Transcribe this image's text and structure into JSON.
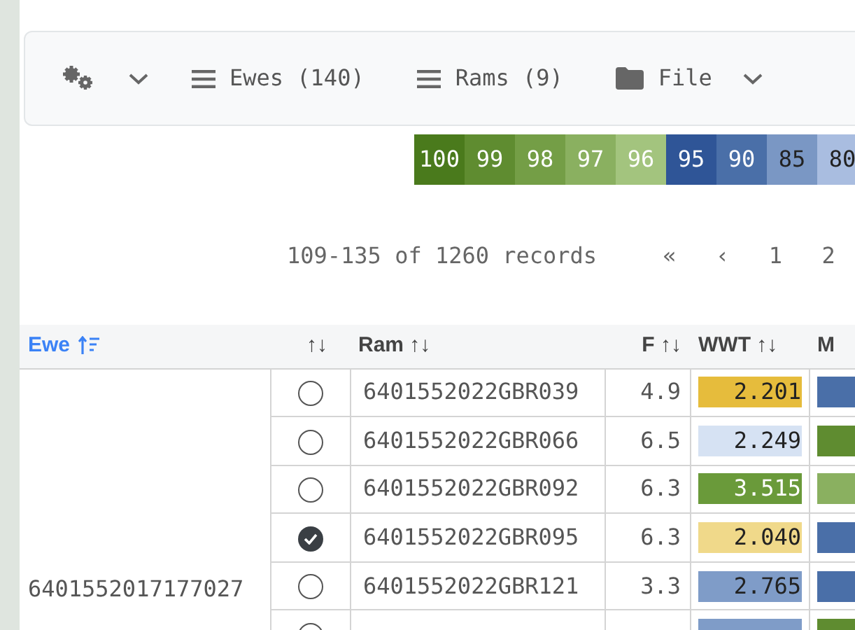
{
  "toolbar": {
    "items": [
      {
        "kind": "settings"
      },
      {
        "kind": "menu",
        "label": "Ewes (140)"
      },
      {
        "kind": "menu",
        "label": "Rams (9)"
      },
      {
        "kind": "folder",
        "label": "File"
      }
    ]
  },
  "legend": [
    {
      "label": "100",
      "color": "#4a7a1c"
    },
    {
      "label": "99",
      "color": "#5f8c30"
    },
    {
      "label": "98",
      "color": "#749e46"
    },
    {
      "label": "97",
      "color": "#8ab060"
    },
    {
      "label": "96",
      "color": "#a3c47e"
    },
    {
      "label": "95",
      "color": "#2f5597"
    },
    {
      "label": "90",
      "color": "#4a6fa8"
    },
    {
      "label": "85",
      "color": "#7a97c4"
    },
    {
      "label": "80",
      "color": "#a9bde0"
    }
  ],
  "pagination": {
    "summary": "109-135 of 1260 records",
    "controls": [
      "«",
      "‹",
      "1",
      "2"
    ]
  },
  "table": {
    "columns": [
      {
        "label": "Ewe",
        "kind": "ewe"
      },
      {
        "label": "↑↓",
        "kind": "select"
      },
      {
        "label": "Ram ↑↓",
        "kind": "ram"
      },
      {
        "label": "F ↑↓",
        "kind": "num"
      },
      {
        "label": "WWT ↑↓",
        "kind": "bar"
      },
      {
        "label": "M",
        "kind": "bar"
      }
    ],
    "ewe": "6401552017177027",
    "rows": [
      {
        "selected": false,
        "ram": "6401552022GBR039",
        "f": "4.9",
        "wwt": {
          "value": "2.201",
          "color": "#e6bc3c"
        },
        "mw": {
          "color": "#4a6fa8"
        }
      },
      {
        "selected": false,
        "ram": "6401552022GBR066",
        "f": "6.5",
        "wwt": {
          "value": "2.249",
          "color": "#d6e2f3"
        },
        "mw": {
          "color": "#5f8c30"
        }
      },
      {
        "selected": false,
        "ram": "6401552022GBR092",
        "f": "6.3",
        "wwt": {
          "value": "3.515",
          "color": "#6a9a3a"
        },
        "mw": {
          "color": "#8ab060"
        }
      },
      {
        "selected": true,
        "ram": "6401552022GBR095",
        "f": "6.3",
        "wwt": {
          "value": "2.040",
          "color": "#f0d98a"
        },
        "mw": {
          "color": "#4a6fa8"
        }
      },
      {
        "selected": false,
        "ram": "6401552022GBR121",
        "f": "3.3",
        "wwt": {
          "value": "2.765",
          "color": "#7f9cc8"
        },
        "mw": {
          "color": "#4a6fa8"
        }
      },
      {
        "selected": false,
        "wwt": {
          "color": "#7f9cc8"
        },
        "mw": {
          "color": "#5f8c30"
        }
      }
    ]
  }
}
